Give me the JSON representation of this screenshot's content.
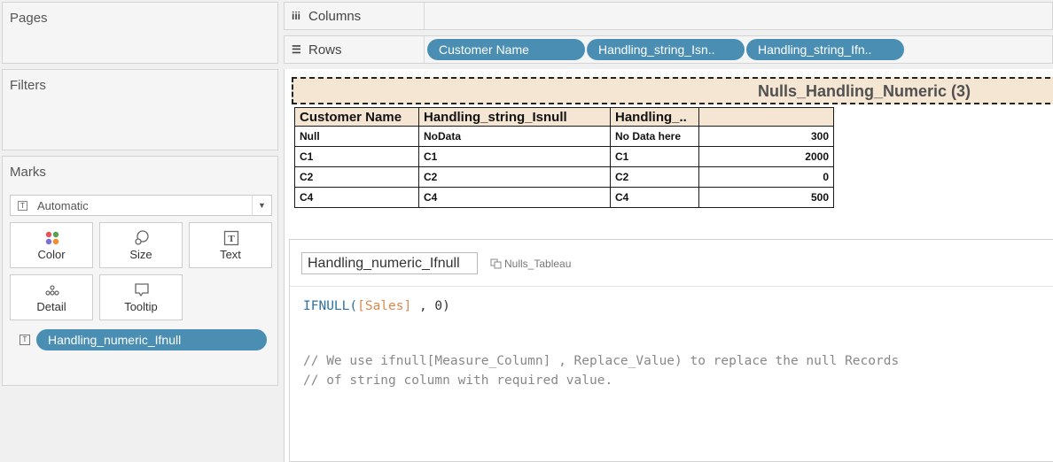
{
  "panels": {
    "pages_title": "Pages",
    "filters_title": "Filters",
    "marks_title": "Marks"
  },
  "marks": {
    "mark_type": "Automatic",
    "buttons": [
      "Color",
      "Size",
      "Text",
      "Detail",
      "Tooltip"
    ],
    "pill": "Handling_numeric_Ifnull"
  },
  "shelves": {
    "columns_label": "Columns",
    "rows_label": "Rows",
    "row_pills": [
      "Customer Name",
      "Handling_string_Isn..",
      "Handling_string_Ifn.."
    ]
  },
  "sheet": {
    "title": "Nulls_Handling_Numeric (3)",
    "headers": [
      "Customer Name",
      "Handling_string_Isnull",
      "Handling_..",
      ""
    ],
    "rows": [
      [
        "Null",
        "NoData",
        "No Data here",
        "300"
      ],
      [
        "C1",
        "C1",
        "C1",
        "2000"
      ],
      [
        "C2",
        "C2",
        "C2",
        "0"
      ],
      [
        "C4",
        "C4",
        "C4",
        "500"
      ]
    ]
  },
  "calc": {
    "name": "Handling_numeric_Ifnull",
    "datasource": "Nulls_Tableau",
    "code_fn": "IFNULL(",
    "code_field": "[Sales]",
    "code_rest": " , 0)",
    "comment_1": "// We use ifnull[Measure_Column] , Replace_Value) to replace the null Records",
    "comment_2": "// of string column with required value."
  },
  "colors": {
    "pill": "#4a8fb3",
    "header_bg": "#f5e6d3",
    "code_function": "#2e6f9e",
    "code_field": "#d58a4e"
  }
}
